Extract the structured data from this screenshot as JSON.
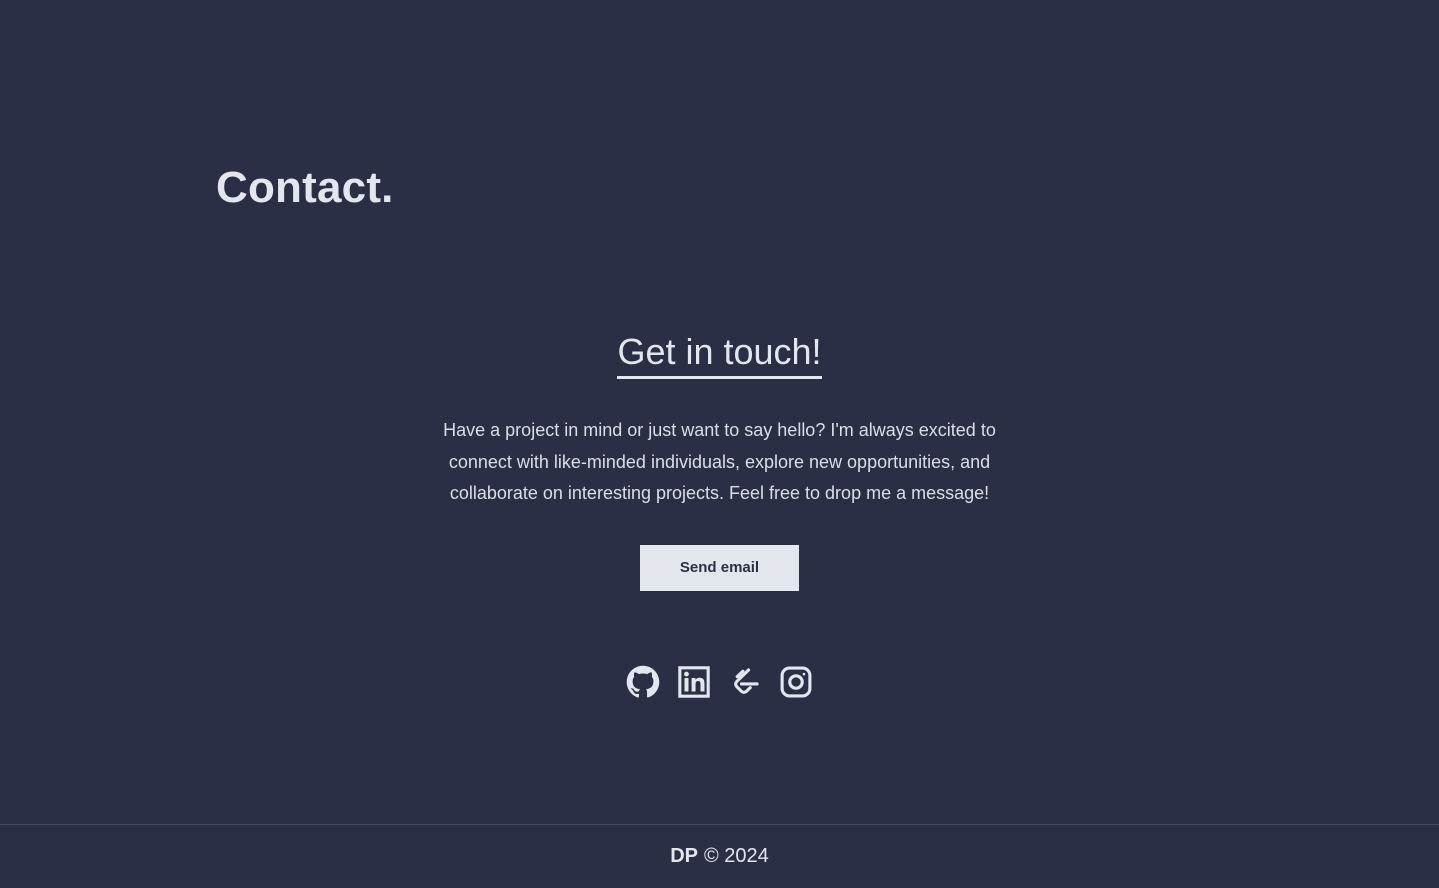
{
  "section": {
    "title": "Contact."
  },
  "contact": {
    "heading": "Get in touch!",
    "description": "Have a project in mind or just want to say hello? I'm always excited to connect with like-minded individuals, explore new opportunities, and collaborate on interesting projects. Feel free to drop me a message!",
    "button_label": "Send email"
  },
  "socials": [
    {
      "icon": "github-icon"
    },
    {
      "icon": "linkedin-icon"
    },
    {
      "icon": "leetcode-icon"
    },
    {
      "icon": "instagram-icon"
    }
  ],
  "footer": {
    "brand": "DP",
    "copyright": "© 2024"
  },
  "colors": {
    "background": "#2a2f45",
    "foreground": "#e4e6ee",
    "divider": "#454a5e"
  }
}
